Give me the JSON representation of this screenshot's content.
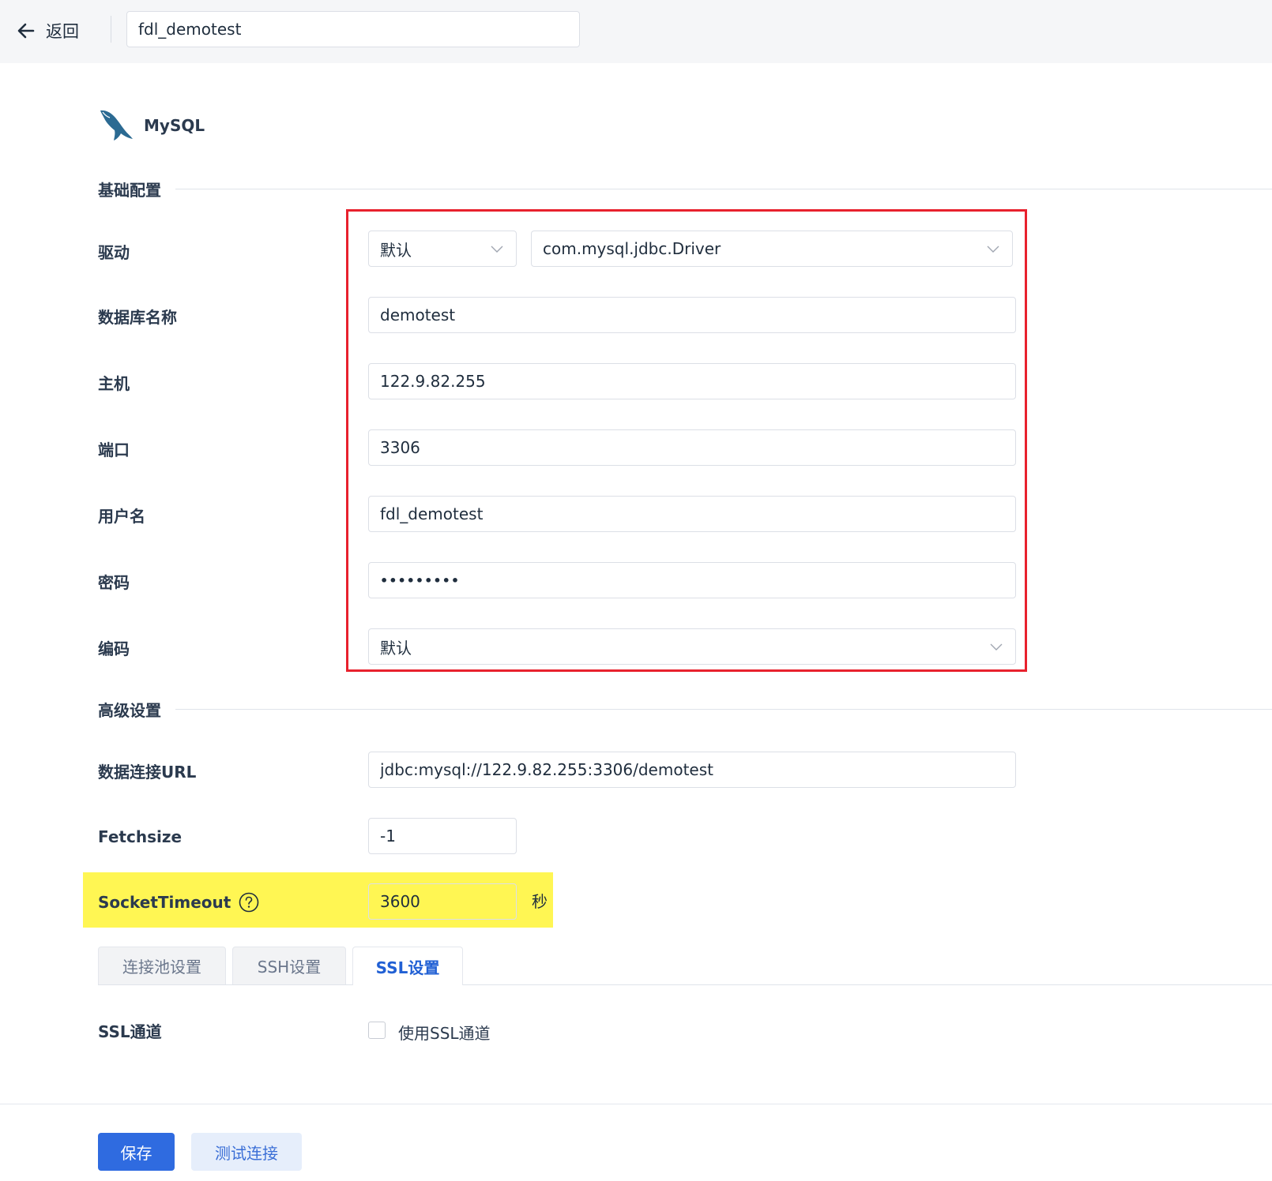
{
  "header": {
    "back_label": "返回",
    "connection_name": "fdl_demotest"
  },
  "database": {
    "type": "MySQL",
    "logo": "mysql-dolphin-logo"
  },
  "basic": {
    "section_title": "基础配置",
    "driver": {
      "label": "驱动",
      "mode": "默认",
      "class": "com.mysql.jdbc.Driver"
    },
    "db_name": {
      "label": "数据库名称",
      "value": "demotest"
    },
    "host": {
      "label": "主机",
      "value": "122.9.82.255"
    },
    "port": {
      "label": "端口",
      "value": "3306"
    },
    "username": {
      "label": "用户名",
      "value": "fdl_demotest"
    },
    "password": {
      "label": "密码",
      "value": "•••••••••"
    },
    "encoding": {
      "label": "编码",
      "value": "默认"
    }
  },
  "advanced": {
    "section_title": "高级设置",
    "url": {
      "label": "数据连接URL",
      "value": "jdbc:mysql://122.9.82.255:3306/demotest"
    },
    "fetchsize": {
      "label": "Fetchsize",
      "value": "-1"
    },
    "socket_timeout": {
      "label": "SocketTimeout",
      "value": "3600",
      "unit": "秒",
      "help_icon": "question-circle-icon"
    }
  },
  "tabs": [
    {
      "label": "连接池设置",
      "active": false
    },
    {
      "label": "SSH设置",
      "active": false
    },
    {
      "label": "SSL设置",
      "active": true
    }
  ],
  "ssl": {
    "label": "SSL通道",
    "checkbox_label": "使用SSL通道",
    "checked": false
  },
  "actions": {
    "save_label": "保存",
    "test_label": "测试连接"
  },
  "colors": {
    "primary": "#2f6be0",
    "highlight_box": "#e8212d",
    "highlight_fill": "#fff653",
    "active_tab": "#2160d4"
  }
}
